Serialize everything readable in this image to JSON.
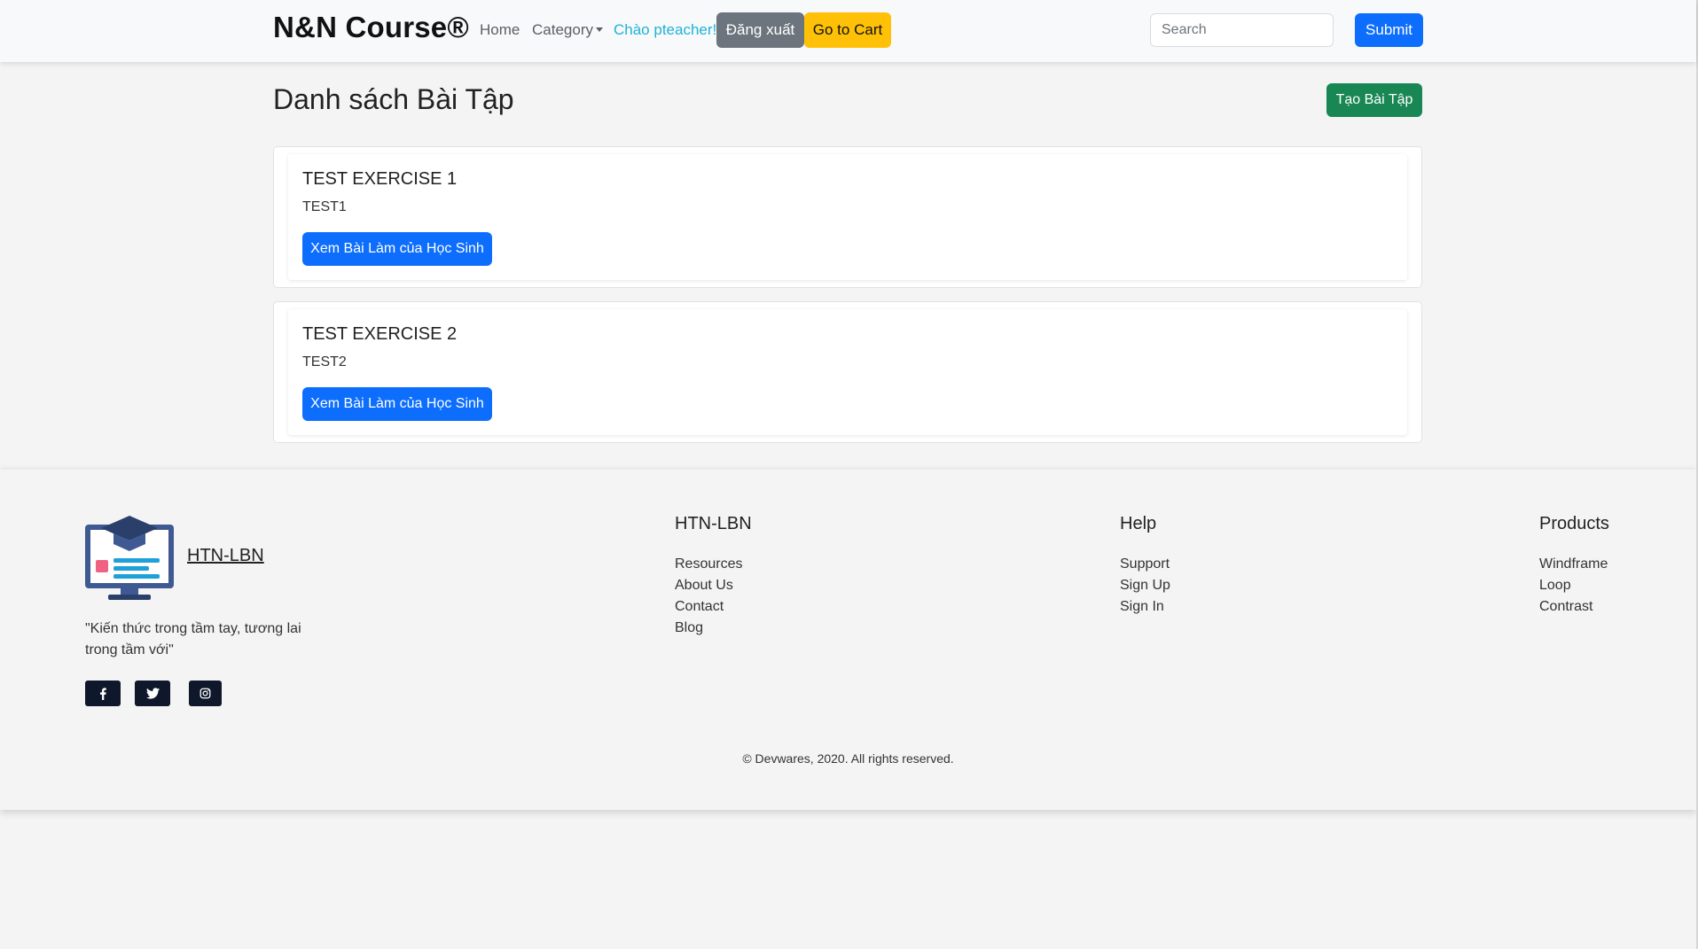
{
  "navbar": {
    "brand": "N&N Course®",
    "home": "Home",
    "category": "Category",
    "greeting": "Chào pteacher!",
    "logout": "Đăng xuất",
    "cart": "Go to Cart",
    "search_placeholder": "Search",
    "submit": "Submit"
  },
  "main": {
    "title": "Danh sách Bài Tập",
    "create_button": "Tạo Bài Tập",
    "exercises": [
      {
        "title": "TEST EXERCISE 1",
        "text": "TEST1",
        "button": "Xem Bài Làm của Học Sinh"
      },
      {
        "title": "TEST EXERCISE 2",
        "text": "TEST2",
        "button": "Xem Bài Làm của Học Sinh"
      }
    ]
  },
  "footer": {
    "logo_text": "HTN-LBN",
    "tagline": "\"Kiến thức trong tầm tay, tương lai trong tầm với\"",
    "social_icons": [
      "facebook-icon",
      "twitter-icon",
      "instagram-icon"
    ],
    "columns": [
      {
        "heading": "HTN-LBN",
        "links": [
          "Resources",
          "About Us",
          "Contact",
          "Blog"
        ]
      },
      {
        "heading": "Help",
        "links": [
          "Support",
          "Sign Up",
          "Sign In"
        ]
      },
      {
        "heading": "Products",
        "links": [
          "Windframe",
          "Loop",
          "Contrast"
        ]
      }
    ],
    "copyright": "© Devwares, 2020. All rights reserved."
  },
  "colors": {
    "primary": "#0d6efd",
    "success": "#198754",
    "secondary": "#6c757d",
    "warning": "#ffc107",
    "info": "#1eb3d6",
    "social_bg": "#0f172a"
  }
}
